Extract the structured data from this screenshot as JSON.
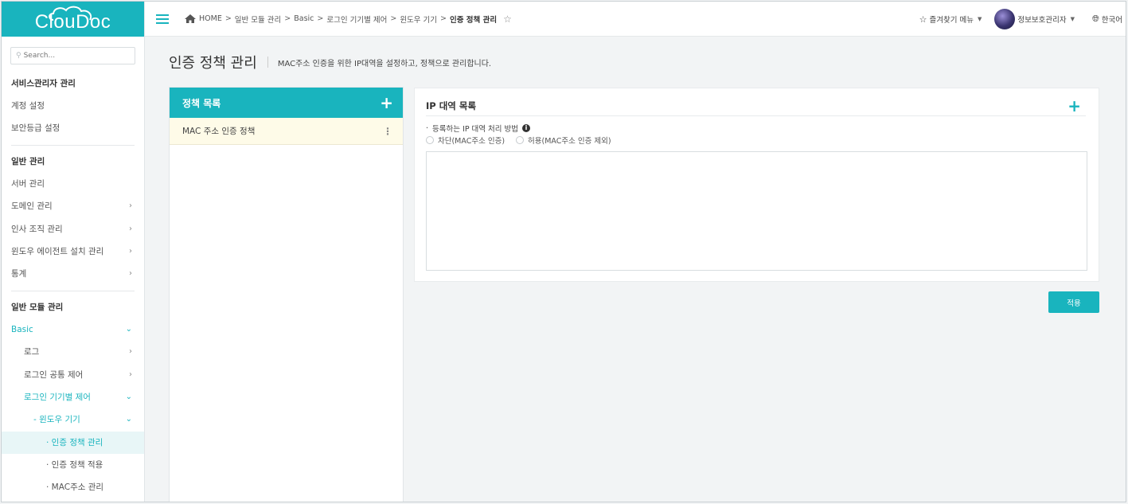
{
  "app": {
    "logo_text": "ClouDoc",
    "accent_color": "#19b4be"
  },
  "search": {
    "placeholder": "Search..."
  },
  "sidebar": {
    "sections": [
      {
        "title": "서비스관리자 관리",
        "items": [
          "계정 설정",
          "보안등급 설정"
        ]
      },
      {
        "title": "일반 관리",
        "items": [
          "서버 관리",
          "도메인 관리",
          "인사 조직 관리",
          "윈도우 에이전트 설치 관리",
          "통계"
        ]
      },
      {
        "title": "일반 모듈 관리"
      }
    ],
    "basic": "Basic",
    "log": "로그",
    "login_common": "로그인 공통 제어",
    "login_device": "로그인 기기별 제어",
    "windows_device": "- 윈도우 기기",
    "auth_policy_mgmt": "· 인증 정책 관리",
    "auth_policy_apply": "· 인증 정책 적용",
    "mac_mgmt": "· MAC주소 관리"
  },
  "topbar": {
    "breadcrumb": [
      "HOME",
      "일반 모듈 관리",
      "Basic",
      "로그인 기기별 제어",
      "윈도우 기기",
      "인증 정책 관리"
    ],
    "sep": ">",
    "favorites": "즐겨찾기 메뉴",
    "user": "정보보호관리자",
    "language": "한국어"
  },
  "page": {
    "title": "인증 정책 관리",
    "description": "MAC주소 인증을 위한 IP대역을 설정하고, 정책으로 관리합니다."
  },
  "policy_list": {
    "title": "정책 목록",
    "items": [
      "MAC 주소 인증 정책"
    ]
  },
  "ip_list": {
    "title": "IP 대역 목록",
    "method_label": "등록하는 IP 대역 처리 방법",
    "options": [
      "차단(MAC주소 인증)",
      "허용(MAC주소 인증 제외)"
    ],
    "textarea_value": ""
  },
  "apply_button": "적용"
}
